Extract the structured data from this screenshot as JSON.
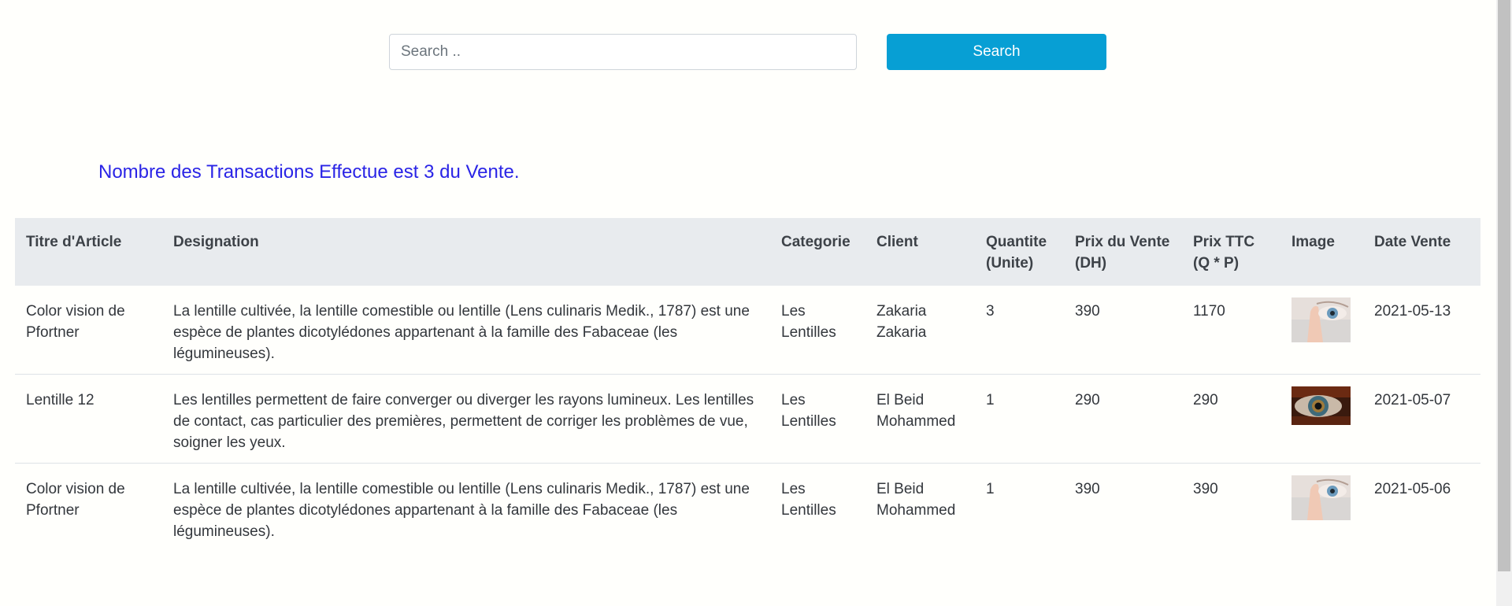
{
  "search": {
    "placeholder": "Search ..",
    "value": "",
    "button_label": "Search"
  },
  "summary": {
    "heading": "Nombre des Transactions Effectue est 3 du Vente."
  },
  "table": {
    "headers": {
      "titre": "Titre d'Article",
      "designation": "Designation",
      "categorie": "Categorie",
      "client": "Client",
      "quantite": "Quantite (Unite)",
      "prix_vente": "Prix du Vente (DH)",
      "prix_ttc": "Prix TTC (Q * P)",
      "image": "Image",
      "date": "Date Vente"
    },
    "rows": [
      {
        "titre": "Color vision de Pfortner",
        "designation": "La lentille cultivée, la lentille comestible ou lentille (Lens culinaris Medik., 1787) est une espèce de plantes dicotylédones appartenant à la famille des Fabaceae (les légumineuses).",
        "categorie": "Les Lentilles",
        "client": "Zakaria Zakaria",
        "quantite": "3",
        "prix_vente": "390",
        "prix_ttc": "1170",
        "image": "contact-lens-finger-eye-image",
        "date": "2021-05-13"
      },
      {
        "titre": "Lentille 12",
        "designation": "Les lentilles permettent de faire converger ou diverger les rayons lumineux. Les lentilles de contact, cas particulier des premières, permettent de corriger les problèmes de vue, soigner les yeux.",
        "categorie": "Les Lentilles",
        "client": "El Beid Mohammed",
        "quantite": "1",
        "prix_vente": "290",
        "prix_ttc": "290",
        "image": "eye-iris-closeup-image",
        "date": "2021-05-07"
      },
      {
        "titre": "Color vision de Pfortner",
        "designation": "La lentille cultivée, la lentille comestible ou lentille (Lens culinaris Medik., 1787) est une espèce de plantes dicotylédones appartenant à la famille des Fabaceae (les légumineuses).",
        "categorie": "Les Lentilles",
        "client": "El Beid Mohammed",
        "quantite": "1",
        "prix_vente": "390",
        "prix_ttc": "390",
        "image": "contact-lens-finger-eye-image",
        "date": "2021-05-06"
      }
    ]
  },
  "colors": {
    "accent_button": "#079fd4",
    "heading_text": "#2a24e6",
    "table_header_bg": "#e8ebee",
    "page_bg": "#fffffc"
  }
}
